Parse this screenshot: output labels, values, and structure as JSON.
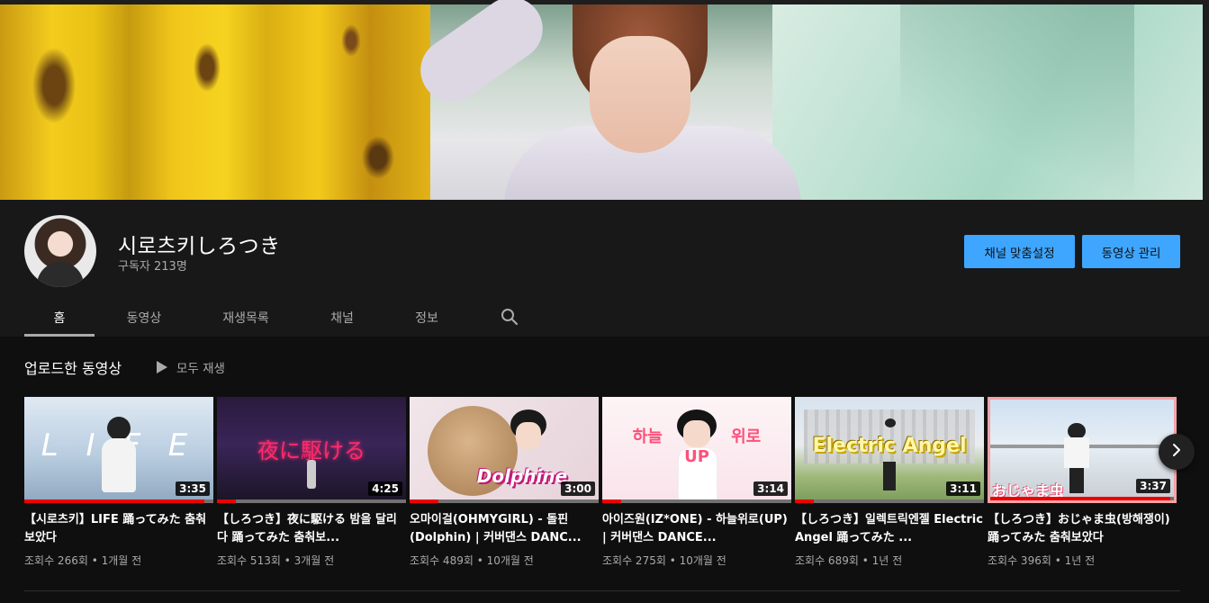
{
  "channel": {
    "name": "시로츠키しろつき",
    "subscribers": "구독자 213명",
    "customize_label": "채널 맞춤설정",
    "manage_label": "동영상 관리"
  },
  "tabs": [
    {
      "label": "홈",
      "active": true
    },
    {
      "label": "동영상",
      "active": false
    },
    {
      "label": "재생목록",
      "active": false
    },
    {
      "label": "채널",
      "active": false
    },
    {
      "label": "정보",
      "active": false
    }
  ],
  "section": {
    "title": "업로드한 동영상",
    "play_all": "모두 재생"
  },
  "videos": [
    {
      "title": "【시로츠키】LIFE 踊ってみた 춤춰보았다",
      "meta": "조회수 266회 • 1개월 전",
      "duration": "3:35",
      "progress": 0.95,
      "thumb_text": "L I F E"
    },
    {
      "title": "【しろつき】夜に駆ける 밤을 달리다 踊ってみた 춤춰보...",
      "meta": "조회수 513회 • 3개월 전",
      "duration": "4:25",
      "progress": 0.1,
      "thumb_text": "夜に駆ける"
    },
    {
      "title": "오마이걸(OHMYGIRL) - 돌핀(Dolphin) | 커버댄스 DANC...",
      "meta": "조회수 489회 • 10개월 전",
      "duration": "3:00",
      "progress": 0.15,
      "thumb_text": "Dolphine"
    },
    {
      "title": "아이즈원(IZ*ONE) - 하늘위로(UP) | 커버댄스 DANCE...",
      "meta": "조회수 275회 • 10개월 전",
      "duration": "3:14",
      "progress": 0.1,
      "thumb_text": "하늘 위로 UP"
    },
    {
      "title": "【しろつき】일렉트릭엔젤 Electric Angel 踊ってみた ...",
      "meta": "조회수 689회 • 1년 전",
      "duration": "3:11",
      "progress": 0.1,
      "thumb_text": "Electric Angel"
    },
    {
      "title": "【しろつき】おじゃま虫(방해쟁이) 踊ってみた 춤춰보았다",
      "meta": "조회수 396회 • 1년 전",
      "duration": "3:37",
      "progress": 0.98,
      "thumb_text": "おじゃま虫"
    }
  ],
  "colors": {
    "accent": "#3ea6ff",
    "progress": "#ee0000",
    "background": "#181818"
  },
  "icons": {
    "search": "search-icon",
    "play": "play-icon",
    "next": "chevron-right-icon"
  }
}
